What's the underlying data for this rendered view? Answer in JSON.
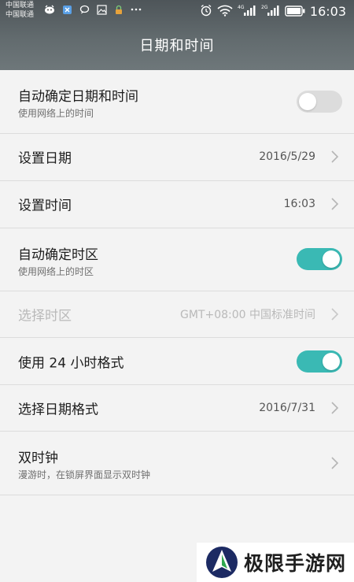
{
  "status_bar": {
    "carrier_1": "中国联通",
    "carrier_2": "中国联通",
    "net_1": "4G",
    "net_2": "2G",
    "time": "16:03"
  },
  "header": {
    "title": "日期和时间"
  },
  "settings": [
    {
      "title": "自动确定日期和时间",
      "subtitle": "使用网络上的时间",
      "toggle": "off"
    },
    {
      "title": "设置日期",
      "value": "2016/5/29"
    },
    {
      "title": "设置时间",
      "value": "16:03"
    },
    {
      "title": "自动确定时区",
      "subtitle": "使用网络上的时区",
      "toggle": "on"
    },
    {
      "title": "选择时区",
      "value": "GMT+08:00 中国标准时间",
      "disabled": true
    },
    {
      "title": "使用 24 小时格式",
      "toggle": "on"
    },
    {
      "title": "选择日期格式",
      "value": "2016/7/31"
    },
    {
      "title": "双时钟",
      "subtitle": "漫游时，在锁屏界面显示双时钟"
    }
  ],
  "watermark": {
    "text": "极限手游网"
  },
  "colors": {
    "accent": "#3ab9b4",
    "header_bg": "#5a6366",
    "toggle_off": "#dcdcdc"
  }
}
